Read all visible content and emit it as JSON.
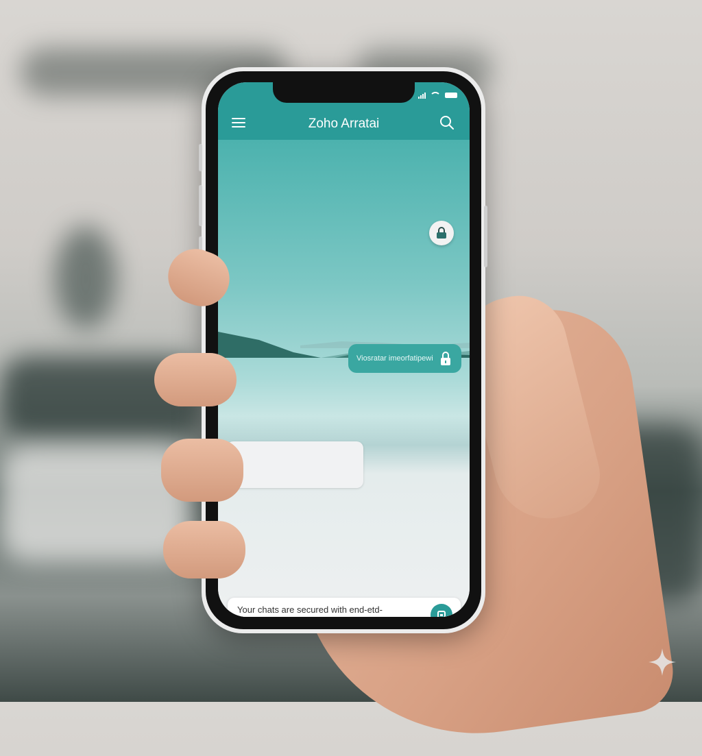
{
  "app": {
    "title": "Zoho Arratai"
  },
  "chat": {
    "outgoing_message": "Viosratar imeorfatipewi",
    "encryption_notice": "Your chats are secured with end-etd-\nenz eerypption. Tap for more info."
  },
  "colors": {
    "accent": "#2a9b98",
    "bubble_out": "#3aa7a1"
  },
  "icons": {
    "menu": "hamburger-menu-icon",
    "search": "search-icon",
    "lock": "lock-icon",
    "back": "nav-back-icon",
    "home": "nav-home-icon",
    "recents": "nav-recents-icon"
  }
}
